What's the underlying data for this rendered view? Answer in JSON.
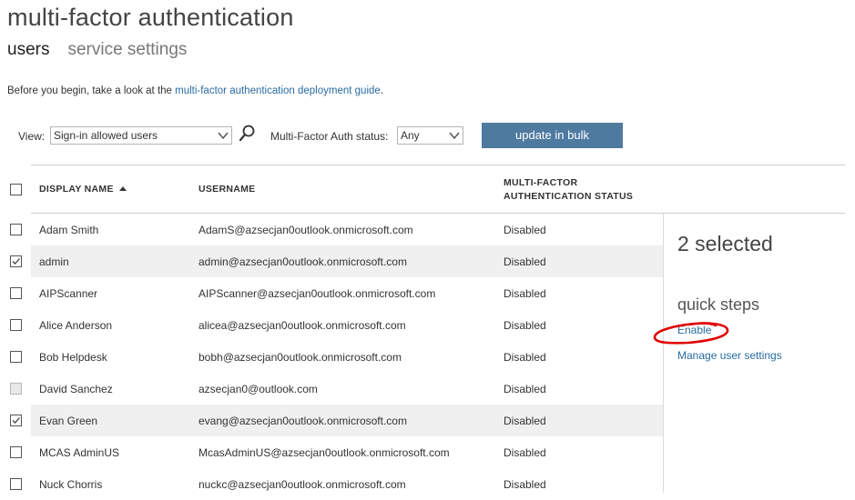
{
  "page_title": "multi-factor authentication",
  "tabs": [
    {
      "label": "users"
    },
    {
      "label": "service settings"
    }
  ],
  "intro": {
    "prefix": "Before you begin, take a look at the ",
    "link": "multi-factor authentication deployment guide",
    "suffix": "."
  },
  "filters": {
    "view_label": "View:",
    "view_value": "Sign-in allowed users",
    "mfa_label": "Multi-Factor Auth status:",
    "mfa_value": "Any"
  },
  "update_bulk_label": "update in bulk",
  "columns": {
    "display_name": "DISPLAY NAME",
    "username": "USERNAME",
    "mfa_status_line1": "MULTI-FACTOR",
    "mfa_status_line2": "AUTHENTICATION STATUS"
  },
  "users": [
    {
      "name": "Adam Smith",
      "username": "AdamS@azsecjan0outlook.onmicrosoft.com",
      "status": "Disabled",
      "checked": false,
      "disabled": false
    },
    {
      "name": "admin",
      "username": "admin@azsecjan0outlook.onmicrosoft.com",
      "status": "Disabled",
      "checked": true,
      "disabled": false
    },
    {
      "name": "AIPScanner",
      "username": "AIPScanner@azsecjan0outlook.onmicrosoft.com",
      "status": "Disabled",
      "checked": false,
      "disabled": false
    },
    {
      "name": "Alice Anderson",
      "username": "alicea@azsecjan0outlook.onmicrosoft.com",
      "status": "Disabled",
      "checked": false,
      "disabled": false
    },
    {
      "name": "Bob Helpdesk",
      "username": "bobh@azsecjan0outlook.onmicrosoft.com",
      "status": "Disabled",
      "checked": false,
      "disabled": false
    },
    {
      "name": "David Sanchez",
      "username": "azsecjan0@outlook.com",
      "status": "Disabled",
      "checked": false,
      "disabled": true
    },
    {
      "name": "Evan Green",
      "username": "evang@azsecjan0outlook.onmicrosoft.com",
      "status": "Disabled",
      "checked": true,
      "disabled": false
    },
    {
      "name": "MCAS AdminUS",
      "username": "McasAdminUS@azsecjan0outlook.onmicrosoft.com",
      "status": "Disabled",
      "checked": false,
      "disabled": false
    },
    {
      "name": "Nuck Chorris",
      "username": "nuckc@azsecjan0outlook.onmicrosoft.com",
      "status": "Disabled",
      "checked": false,
      "disabled": false
    }
  ],
  "side_panel": {
    "selected_count": "2 selected",
    "quick_steps_title": "quick steps",
    "enable_label": "Enable",
    "manage_label": "Manage user settings"
  },
  "icons": {
    "search": "search-icon",
    "dropdown": "chevron-down-icon",
    "checkbox": "checkbox-icon",
    "sort": "sort-ascending-icon"
  },
  "colors": {
    "accent_button": "#4f7aa0",
    "link": "#2a6ca3",
    "selected_row": "#f0f0f0",
    "annotation_circle": "#e00000"
  }
}
